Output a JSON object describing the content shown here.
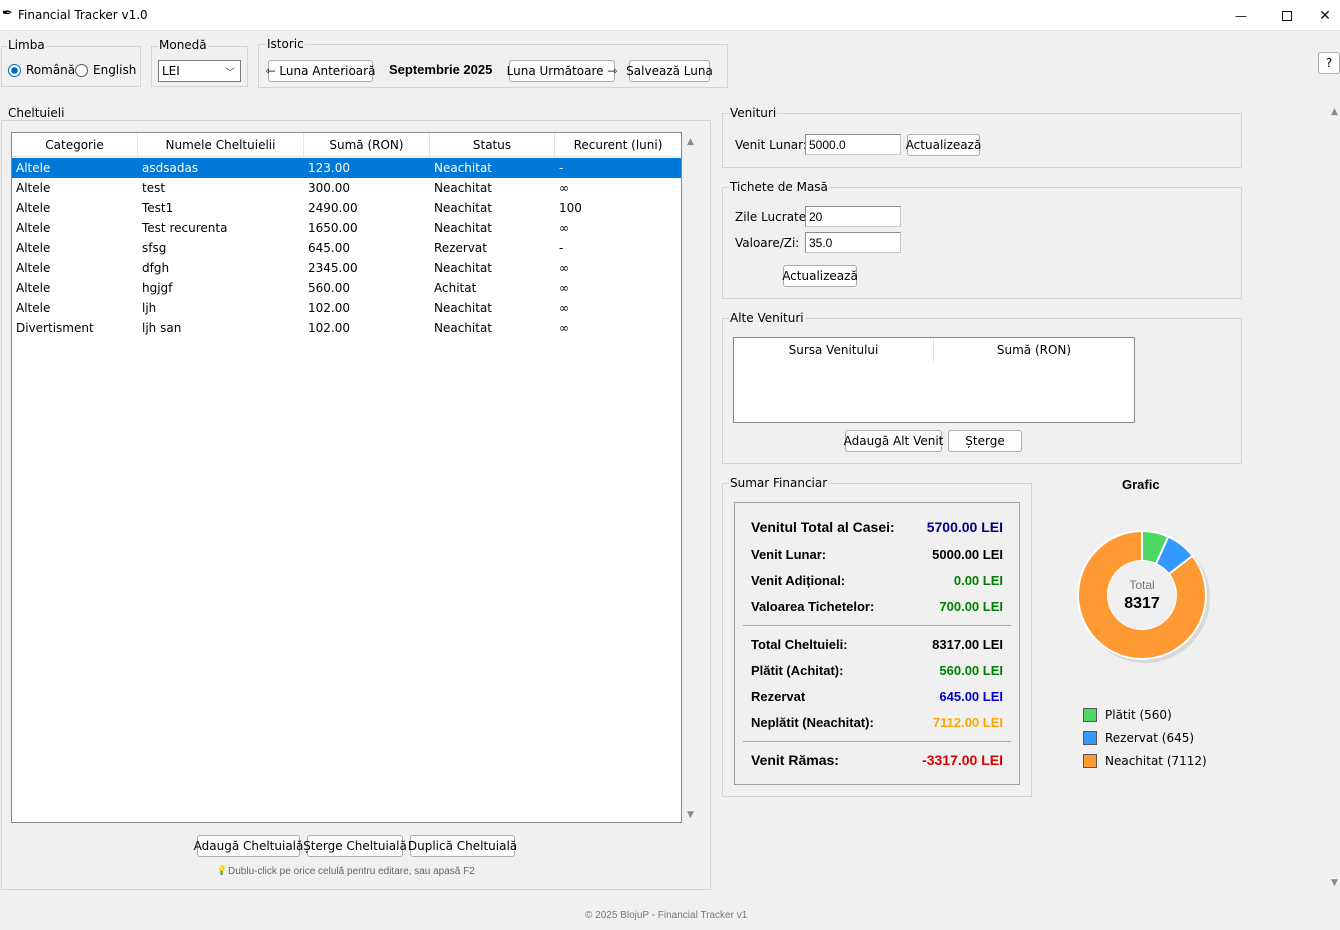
{
  "window": {
    "title": "Financial Tracker v1.0",
    "minimize": "—",
    "maximize": "☐",
    "close": "✕"
  },
  "help_button": "?",
  "language": {
    "label": "Limba",
    "options": [
      "Română",
      "English"
    ],
    "selected": "Română"
  },
  "currency": {
    "label": "Monedă",
    "value": "LEI"
  },
  "history": {
    "label": "Istoric",
    "prev": "⇽ Luna Anterioară",
    "month": "Septembrie 2025",
    "next": "Luna Următoare ⇾",
    "save": "Salvează Luna"
  },
  "expenses": {
    "label": "Cheltuieli",
    "columns": [
      "Categorie",
      "Numele Cheltuielii",
      "Sumă (RON)",
      "Status",
      "Recurent (luni)"
    ],
    "rows": [
      [
        "Altele",
        "asdsadas",
        "123.00",
        "Neachitat",
        "-"
      ],
      [
        "Altele",
        "test",
        "300.00",
        "Neachitat",
        "∞"
      ],
      [
        "Altele",
        "Test1",
        "2490.00",
        "Neachitat",
        "100"
      ],
      [
        "Altele",
        "Test recurenta",
        "1650.00",
        "Neachitat",
        "∞"
      ],
      [
        "Altele",
        "sfsg",
        "645.00",
        "Rezervat",
        "-"
      ],
      [
        "Altele",
        "dfgh",
        "2345.00",
        "Neachitat",
        "∞"
      ],
      [
        "Altele",
        "hgjgf",
        "560.00",
        "Achitat",
        "∞"
      ],
      [
        "Altele",
        "ljh",
        "102.00",
        "Neachitat",
        "∞"
      ],
      [
        "Divertisment",
        "ljh san",
        "102.00",
        "Neachitat",
        "∞"
      ]
    ],
    "selected_row": 0,
    "add": "Adaugă Cheltuială",
    "delete": "Șterge Cheltuială",
    "duplicate": "Duplică Cheltuială",
    "hint": "Dublu-click pe orice celulă pentru editare, sau apasă F2"
  },
  "income": {
    "label": "Venituri",
    "monthly_label": "Venit Lunar:",
    "monthly_value": "5000.0",
    "update": "Actualizează"
  },
  "meal": {
    "label": "Tichete de Masă",
    "days_label": "Zile Lucrate:",
    "days_value": "20",
    "value_label": "Valoare/Zi:",
    "value_value": "35.0",
    "update": "Actualizează"
  },
  "other_income": {
    "label": "Alte Venituri",
    "columns": [
      "Sursa Venitului",
      "Sumă (RON)"
    ],
    "add": "Adaugă Alt Venit",
    "delete": "Șterge"
  },
  "summary": {
    "label": "Sumar Financiar",
    "rows": [
      {
        "label": "Venitul Total al Casei:",
        "value": "5700.00 LEI",
        "color": "#00008b"
      },
      {
        "label": "Venit Lunar:",
        "value": "5000.00 LEI",
        "color": "#000000"
      },
      {
        "label": "Venit Adițional:",
        "value": "0.00 LEI",
        "color": "#008000"
      },
      {
        "label": "Valoarea Tichetelor:",
        "value": "700.00 LEI",
        "color": "#008000"
      },
      {
        "label": "Total Cheltuieli:",
        "value": "8317.00 LEI",
        "color": "#000000"
      },
      {
        "label": "Plătit (Achitat):",
        "value": "560.00 LEI",
        "color": "#008000"
      },
      {
        "label": "Rezervat",
        "value": "645.00 LEI",
        "color": "#0000cd"
      },
      {
        "label": "Neplătit (Neachitat):",
        "value": "7112.00 LEI",
        "color": "#ffa500"
      },
      {
        "label": "Venit Rămas:",
        "value": "-3317.00 LEI",
        "color": "#e00000"
      }
    ]
  },
  "chart_data": {
    "type": "pie",
    "title": "Grafic",
    "center_label": "Total",
    "center_value": "8317",
    "categories": [
      "Plătit",
      "Rezervat",
      "Neachitat"
    ],
    "values": [
      560,
      645,
      7112
    ],
    "colors": [
      "#4cd964",
      "#3399ff",
      "#ff9933"
    ],
    "legend": [
      "Plătit (560)",
      "Rezervat (645)",
      "Neachitat (7112)"
    ],
    "legend_position": "bottom-left"
  },
  "footer": "© 2025 BlojuP - Financial Tracker v1"
}
